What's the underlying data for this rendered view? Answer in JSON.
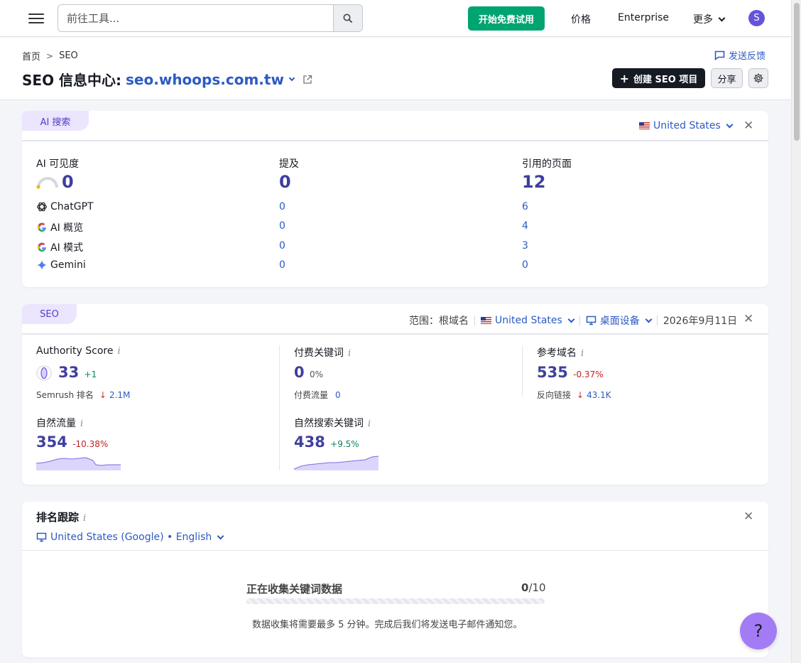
{
  "topbar": {
    "search_placeholder": "前往工具...",
    "trial_label": "开始免费试用",
    "price_label": "价格",
    "enterprise_label": "Enterprise",
    "more_label": "更多",
    "avatar_letter": "S"
  },
  "header": {
    "breadcrumb_home": "首页",
    "breadcrumb_current": "SEO",
    "title_prefix": "SEO 信息中心:",
    "domain": "seo.whoops.com.tw",
    "feedback_label": "发送反馈",
    "create_label": "创建 SEO 项目",
    "share_label": "分享"
  },
  "ai_card": {
    "tab_label": "AI 搜索",
    "country": "United States",
    "col1_title": "AI 可见度",
    "col1_value": "0",
    "col2_title": "提及",
    "col2_value": "0",
    "col3_title": "引用的页面",
    "col3_value": "12",
    "rows": [
      {
        "label": "ChatGPT",
        "mentions": "0",
        "pages": "6",
        "icon": "chatgpt-icon"
      },
      {
        "label": "AI 概览",
        "mentions": "0",
        "pages": "4",
        "icon": "google-icon"
      },
      {
        "label": "AI 模式",
        "mentions": "0",
        "pages": "3",
        "icon": "google-icon"
      },
      {
        "label": "Gemini",
        "mentions": "0",
        "pages": "0",
        "icon": "gemini-icon"
      }
    ]
  },
  "seo_card": {
    "tab_label": "SEO",
    "scope_label": "范围：根域名",
    "country": "United States",
    "device": "桌面设备",
    "date": "2026年9月11日",
    "authority": {
      "title": "Authority Score",
      "value": "33",
      "change": "+1",
      "sub_label": "Semrush 排名",
      "sub_value": "2.1M"
    },
    "paid": {
      "title": "付费关键词",
      "value": "0",
      "change": "0%",
      "sub_label": "付费流量",
      "sub_value": "0"
    },
    "referring": {
      "title": "参考域名",
      "value": "535",
      "change": "-0.37%",
      "sub_label": "反向链接",
      "sub_value": "43.1K"
    },
    "organic_traffic": {
      "title": "自然流量",
      "value": "354",
      "change": "-10.38%"
    },
    "organic_keywords": {
      "title": "自然搜索关键词",
      "value": "438",
      "change": "+9.5%"
    }
  },
  "rank_card": {
    "title": "排名跟踪",
    "location": "United States (Google) • English",
    "collecting_label": "正在收集关键词数据",
    "progress_done": "0",
    "progress_total": "/10",
    "progress_fraction": 0,
    "note": "数据收集将需要最多 5 分钟。完成后我们将发送电子邮件通知您。"
  },
  "help": {
    "label": "?"
  },
  "colors": {
    "accent": "#2d5bc4",
    "trial_green": "#00a470",
    "tab_purple": "#ebe5fd",
    "help_purple": "#a37cf5"
  }
}
